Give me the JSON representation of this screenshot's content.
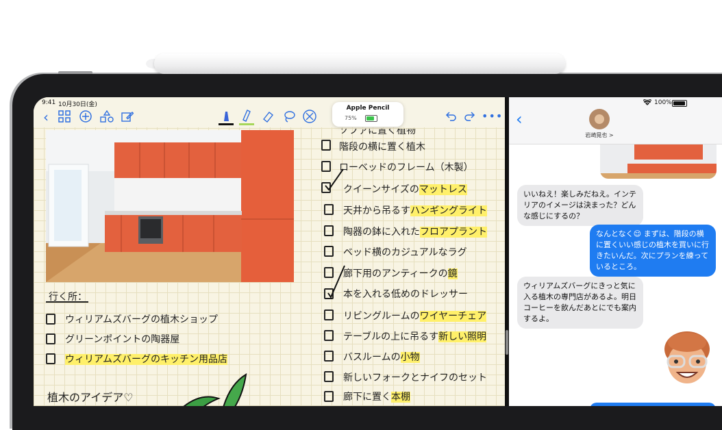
{
  "status": {
    "time": "9:41",
    "date": "10月30日(金)",
    "battery": "100%"
  },
  "toolbar": {
    "back_icon": "chevron-left-icon",
    "grid_icon": "grid-icon",
    "add_icon": "plus-circle-icon",
    "shapes_icon": "shapes-icon",
    "compose_icon": "compose-icon",
    "undo_icon": "undo-icon",
    "redo_icon": "redo-icon",
    "more_icon": "ellipsis-icon",
    "accent": "#2f6fe0"
  },
  "pencil_popup": {
    "title": "Apple Pencil",
    "battery": "75%"
  },
  "notes": {
    "left_heading": "行く所：",
    "left_items": [
      {
        "text": "ウィリアムズバーグの植木ショップ",
        "highlight": ""
      },
      {
        "text": "グリーンポイントの陶器屋",
        "highlight": ""
      },
      {
        "text": "ウィリアムズバーグの",
        "highlight": "キッチン用品店"
      }
    ],
    "ideas_heading": "植木のアイデア♡",
    "right_items": [
      {
        "text": "ソファに置く植物",
        "highlight": ""
      },
      {
        "text": "階段の横に置く植木",
        "highlight": ""
      },
      {
        "text": "ローベッドのフレーム（木製）",
        "highlight": ""
      },
      {
        "text": "クイーンサイズの",
        "highlight": "マットレス"
      },
      {
        "text": "天井から吊るす",
        "highlight": "ハンギングライト"
      },
      {
        "text": "陶器の鉢に入れた",
        "highlight": "フロアプラント"
      },
      {
        "text": "ベッド横のカジュアルなラグ",
        "highlight": ""
      },
      {
        "text": "廊下用のアンティークの",
        "highlight": "鏡"
      },
      {
        "text": "本を入れる低めのドレッサー",
        "highlight": ""
      },
      {
        "text": "リビングルームの",
        "highlight": "ワイヤーチェア"
      },
      {
        "text": "テーブルの上に吊るす",
        "highlight": "新しい照明"
      },
      {
        "text": "バスルームの",
        "highlight": "小物"
      },
      {
        "text": "新しいフォークとナイフのセット",
        "highlight": ""
      },
      {
        "text": "廊下に置く",
        "highlight": "本棚"
      }
    ]
  },
  "messages": {
    "contact_name": "岩崎晃也 >",
    "back_icon": "chevron-left-icon",
    "bubbles": [
      {
        "side": "left",
        "text": "いいねえ！楽しみだねえ。インテリアのイメージは決まった？どんな感じにするの？"
      },
      {
        "side": "right",
        "text": "なんとなく😌 まずは、階段の横に置くいい感じの植木を買いに行きたいんだ。次にプランを練っているところ。"
      },
      {
        "side": "left",
        "text": "ウィリアムズバーグにきっと気に入る植木の専門店があるよ。明日コーヒーを飲んだあとにでも案内するよ。"
      }
    ]
  }
}
